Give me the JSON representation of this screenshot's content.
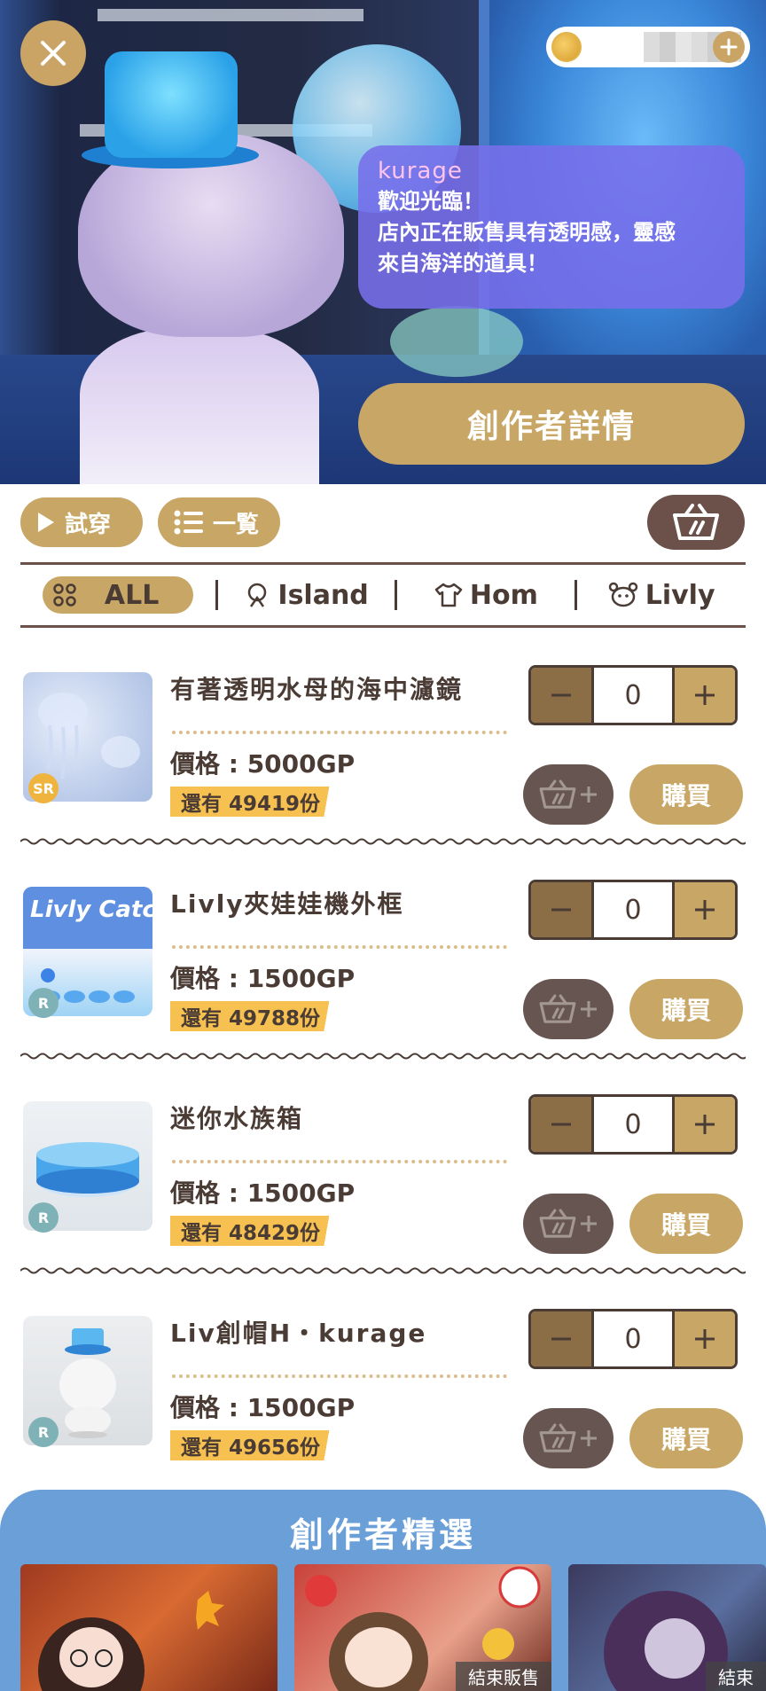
{
  "hero": {
    "speaker": "kurage",
    "message": "歡迎光臨！\n店內正在販售具有透明感，靈感\n來自海洋的道具！",
    "creator_button": "創作者詳情"
  },
  "toolbar": {
    "try_on": "試穿",
    "list": "一覧"
  },
  "filters": [
    {
      "label": "ALL",
      "icon": "dots-icon",
      "active": true
    },
    {
      "label": "Island",
      "icon": "island-icon",
      "active": false
    },
    {
      "label": "Hom",
      "icon": "shirt-icon",
      "active": false
    },
    {
      "label": "Livly",
      "icon": "livly-icon",
      "active": false
    }
  ],
  "items": [
    {
      "name": "有著透明水母的海中濾鏡",
      "rarity": "SR",
      "price": "價格 : 5000GP",
      "stock": "還有 49419份",
      "qty": "0",
      "buy": "購買"
    },
    {
      "name": "Livly夾娃娃機外框",
      "rarity": "R",
      "price": "價格 : 1500GP",
      "stock": "還有 49788份",
      "qty": "0",
      "buy": "購買"
    },
    {
      "name": "迷你水族箱",
      "rarity": "R",
      "price": "價格 : 1500GP",
      "stock": "還有 48429份",
      "qty": "0",
      "buy": "購買"
    },
    {
      "name": "Liv創帽H・kurage",
      "rarity": "R",
      "price": "價格 : 1500GP",
      "stock": "還有 49656份",
      "qty": "0",
      "buy": "購買"
    }
  ],
  "thumb_text": {
    "livly_catcher": "Livly Catcher"
  },
  "featured": {
    "title": "創作者精選",
    "cards": [
      {
        "ended": ""
      },
      {
        "ended": "結束販售"
      },
      {
        "ended": "結束"
      }
    ]
  },
  "colors": {
    "gold": "#c8a766",
    "dark_brown": "#4a3b35",
    "featured_blue": "#6a9fd8",
    "bubble_purple": "#786eeb"
  }
}
